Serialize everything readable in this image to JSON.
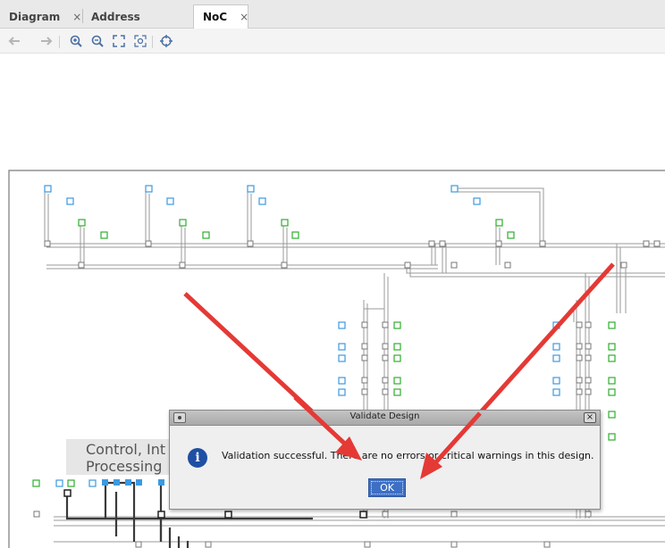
{
  "tabs": [
    {
      "label": "Diagram",
      "close": "×",
      "active": false
    },
    {
      "label": "Address Editor",
      "close": "×",
      "active": false
    },
    {
      "label": "NoC",
      "close": "×",
      "active": true
    }
  ],
  "toolbar": {
    "items": [
      "back-icon",
      "forward-icon",
      "zoom-in-icon",
      "zoom-out-icon",
      "zoom-fit-icon",
      "zoom-selection-icon",
      "target-icon"
    ]
  },
  "diagram": {
    "block_label_line1": "Control, Int",
    "block_label_line2": "Processing"
  },
  "dialog": {
    "title": "Validate Design",
    "message": "Validation successful. There are no errors or critical warnings in this design.",
    "ok_label": "OK",
    "close_glyph": "×",
    "info_glyph": "i"
  },
  "colors": {
    "annotation_arrow": "#e53935",
    "dialog_button": "#3d6fc4",
    "info_icon": "#1f4fa3",
    "node_blue": "#3b9ae1",
    "node_green": "#2fae2f"
  }
}
